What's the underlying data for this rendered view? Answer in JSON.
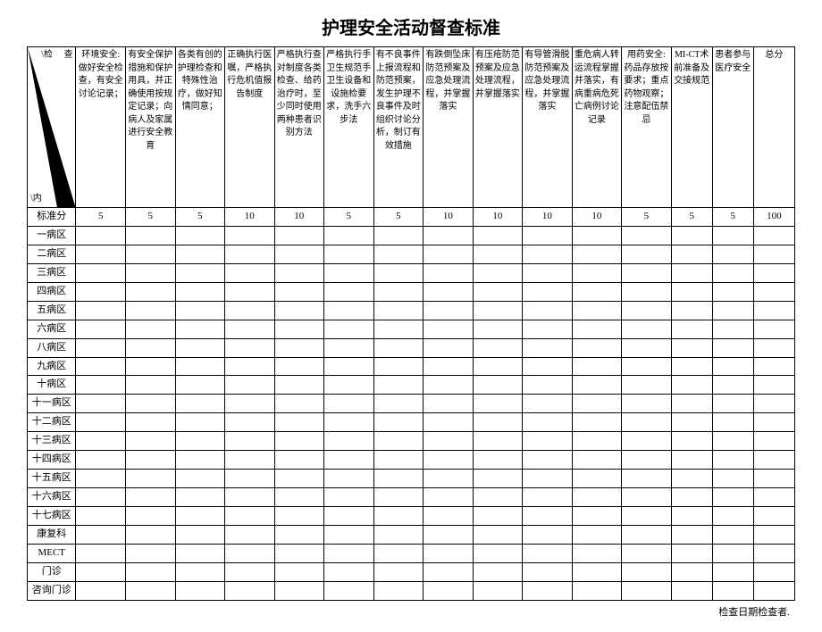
{
  "title": "护理安全活动督查标准",
  "diagonal": {
    "top": "\\检\n　查",
    "bottom": "\\内"
  },
  "columns": [
    "环境安全:做好安全检查，有安全讨论记录；",
    "有安全保护措施和保护用具，并正确使用按规定记录；向病人及家属进行安全教育",
    "各类有创的护理检查和特殊性治疗，做好知情同意；",
    "正确执行医嘱，严格执行危机值报告制度",
    "严格执行查对制度各类检查、给药治疗时，至少同时使用两种患者识别方法",
    "严格执行手卫生规范手卫生设备和设施检要求，洗手六步法",
    "有不良事件上报流程和防范预案，发生护理不良事件及时组织讨论分析，制订有效措施",
    "有跌倒坠床防范预案及应急处理流程，并掌握落实",
    "有压疮防范预案及应急处理流程，并掌握落实",
    "有导管滑脱防范预案及应急处理流程，并掌握落实",
    "重危病人转运流程掌握并落实，有病重病危死亡病例讨论记录",
    "用药安全:药品存放按要求；重点药物观察；注意配伍禁忌",
    "MI-CT术前准备及交接规范",
    "患者参与医疗安全",
    "总分"
  ],
  "standardLabel": "标准分",
  "standards": [
    "5",
    "5",
    "5",
    "10",
    "10",
    "5",
    "5",
    "10",
    "10",
    "10",
    "10",
    "5",
    "5",
    "5",
    "100"
  ],
  "rows": [
    "一病区",
    "二病区",
    "三病区",
    "四病区",
    "五病区",
    "六病区",
    "八病区",
    "九病区",
    "十病区",
    "十一病区",
    "十二病区",
    "十三病区",
    "十四病区",
    "十五病区",
    "十六病区",
    "十七病区",
    "康复科",
    "MECT",
    "门诊",
    "咨询门诊"
  ],
  "footer": "检查日期检查者."
}
